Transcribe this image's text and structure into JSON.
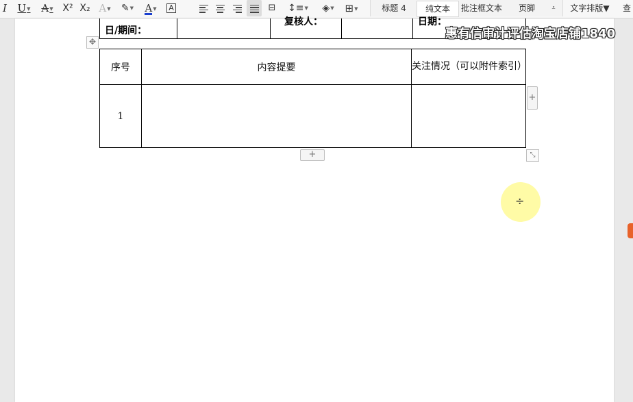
{
  "toolbar": {
    "italic": "I",
    "underline": "U",
    "strike": "A",
    "superscript": "X²",
    "subscript": "X₂",
    "text_effect": "A",
    "highlight": "✎",
    "font_color": "A",
    "char_border": "A",
    "styles": {
      "heading4": "标题 4",
      "plain_text": "纯文本",
      "comment_text": "批注框文本",
      "footer": "页脚",
      "layout": "文字排版",
      "more": "查"
    },
    "font_color_hex": "#1a3fd0"
  },
  "watermark": "惠有信审计评估淘宝店铺1840",
  "top_table": {
    "date_label": "日/期间：",
    "reviewer_label": "复核人：",
    "date2_label": "日期："
  },
  "main_table": {
    "headers": [
      "序号",
      "内容提要",
      "关注情况（可以附件索引）"
    ],
    "rows": [
      {
        "no": "1",
        "summary": "",
        "attention": ""
      }
    ]
  },
  "cursor": {
    "glyph": "÷",
    "halo_color": "#fff796"
  },
  "controls": {
    "add_column": "+",
    "add_row": "+",
    "move": "✥",
    "resize": "⤡"
  }
}
